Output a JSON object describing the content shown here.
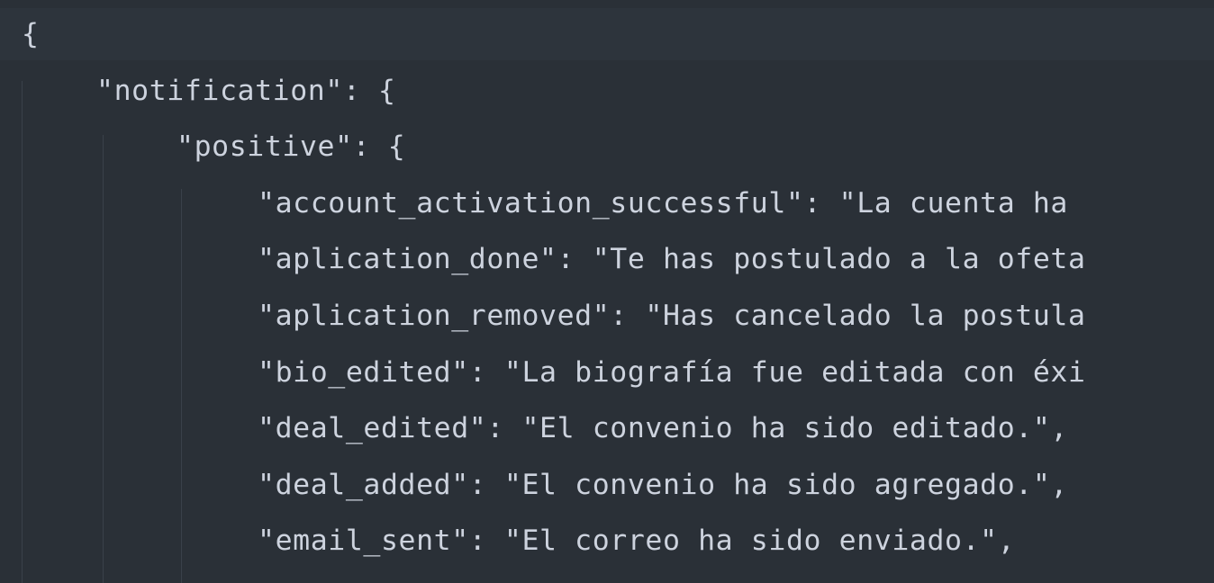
{
  "editor": {
    "lines": [
      "{",
      "\"notification\": {",
      "\"positive\": {",
      "\"account_activation_successful\": \"La cuenta ha",
      "\"aplication_done\": \"Te has postulado a la ofeta",
      "\"aplication_removed\": \"Has cancelado la postula",
      "\"bio_edited\": \"La biografía fue editada con éxi",
      "\"deal_edited\": \"El convenio ha sido editado.\",",
      "\"deal_added\": \"El convenio ha sido agregado.\",",
      "\"email_sent\": \"El correo ha sido enviado.\","
    ]
  },
  "colors": {
    "background": "#2a3037",
    "text": "#cdd3de",
    "indent_guide": "#3a414a"
  }
}
